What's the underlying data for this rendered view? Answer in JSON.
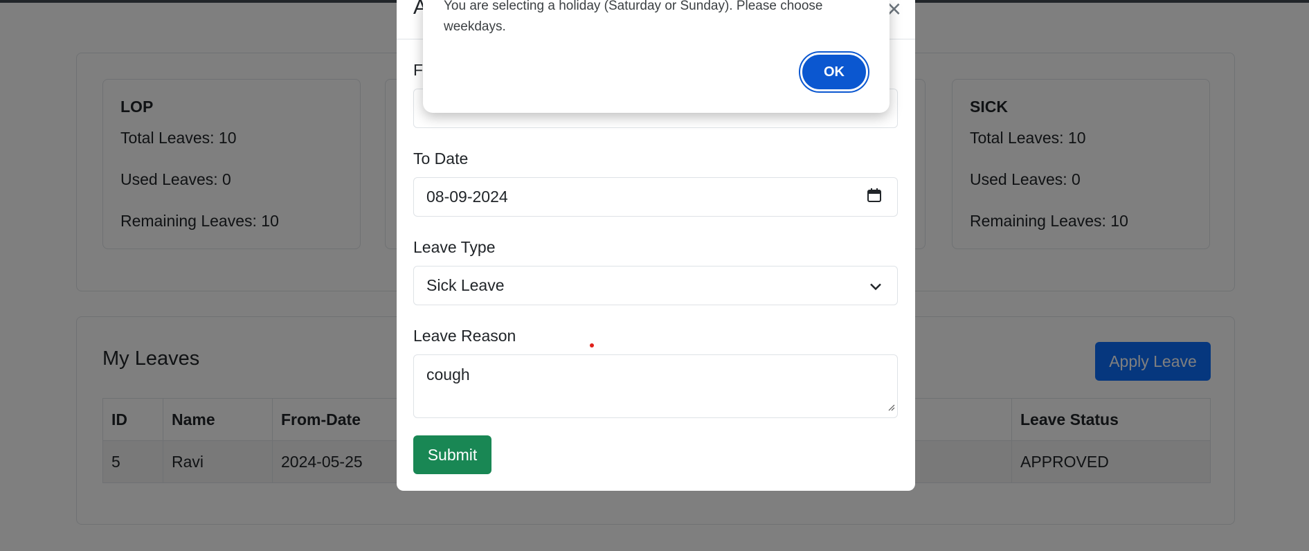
{
  "stats": {
    "cards": [
      {
        "title": "LOP",
        "total": "Total Leaves: 10",
        "used": "Used Leaves: 0",
        "remaining": "Remaining Leaves: 10"
      },
      {
        "title": "SICK",
        "total": "Total Leaves: 10",
        "used": "Used Leaves: 0",
        "remaining": "Remaining Leaves: 10"
      }
    ]
  },
  "leaves": {
    "title": "My Leaves",
    "apply_label": "Apply Leave",
    "columns": {
      "id": "ID",
      "name": "Name",
      "from_date": "From-Date",
      "status": "Leave Status"
    },
    "rows": [
      {
        "id": "5",
        "name": "Ravi",
        "from_date": "2024-05-25",
        "status": "APPROVED"
      }
    ]
  },
  "modal": {
    "title_partial": "A",
    "close_glyph": "×",
    "from_label_partial": "Fr",
    "to_date_label": "To Date",
    "to_date_value": "08-09-2024",
    "leave_type_label": "Leave Type",
    "leave_type_value": "Sick Leave",
    "reason_label": "Leave Reason",
    "reason_value": "cough",
    "submit_label": "Submit"
  },
  "alert": {
    "message": "You are selecting a holiday (Saturday or Sunday). Please choose weekdays.",
    "ok_label": "OK"
  },
  "icons": {
    "date": "calendar-icon",
    "select": "chevron-down-icon",
    "resize": "resize-grip-icon"
  }
}
